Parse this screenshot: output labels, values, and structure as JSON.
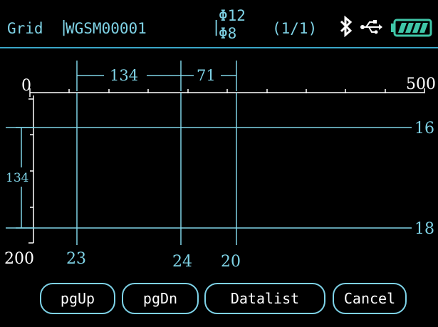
{
  "header": {
    "mode_label": "Grid",
    "separator": "|",
    "device_id": "WGSM00001",
    "diameter_top": "Φ12",
    "diameter_bottom": "Φ8",
    "page_indicator": "(1/1)",
    "icons": [
      "bluetooth-icon",
      "usb-icon",
      "battery-icon"
    ]
  },
  "grid": {
    "top_scale_start": "0",
    "top_scale_end": "500",
    "top_dim_1": "134",
    "top_dim_2": "71",
    "left_scale_bottom": "200",
    "left_dim": "134",
    "row_labels": [
      "16",
      "18"
    ],
    "col_labels": [
      "23",
      "24",
      "20"
    ]
  },
  "buttons": {
    "pgup": "pgUp",
    "pgdn": "pgDn",
    "datalist": "Datalist",
    "cancel": "Cancel"
  },
  "colors": {
    "accent": "#7fd3e6",
    "line": "#3aa6c8",
    "white_text": "#ffffff",
    "background": "#000000"
  }
}
